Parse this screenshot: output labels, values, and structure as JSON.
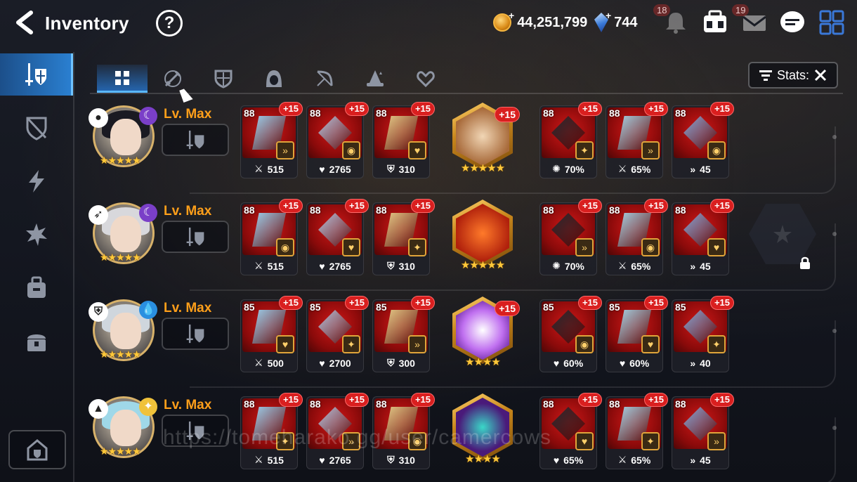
{
  "header": {
    "title": "Inventory",
    "help": "?",
    "gold": "44,251,799",
    "crystals": "744",
    "notifications": "18",
    "mail": "19"
  },
  "tabs": [
    "all",
    "weapon",
    "armor",
    "helmet",
    "bow",
    "mage",
    "extra"
  ],
  "stats_button": {
    "label": "Stats:"
  },
  "heroes": [
    {
      "level": "Lv. Max",
      "element": "dark",
      "class": "thief",
      "hero_stars": "★★★★★",
      "slots": [
        {
          "lvl": "88",
          "enh": "+15",
          "stat": "515",
          "stat_icon": "attack"
        },
        {
          "lvl": "88",
          "enh": "+15",
          "stat": "2765",
          "stat_icon": "health"
        },
        {
          "lvl": "88",
          "enh": "+15",
          "stat": "310",
          "stat_icon": "defense"
        }
      ],
      "artifact": {
        "enh": "+15",
        "stars": "★★★★★"
      },
      "slots2": [
        {
          "lvl": "88",
          "enh": "+15",
          "stat": "70%",
          "stat_icon": "crit-damage"
        },
        {
          "lvl": "88",
          "enh": "+15",
          "stat": "65%",
          "stat_icon": "attack"
        },
        {
          "lvl": "88",
          "enh": "+15",
          "stat": "45",
          "stat_icon": "speed"
        }
      ]
    },
    {
      "level": "Lv. Max",
      "element": "dark",
      "class": "ranger",
      "hero_stars": "★★★★★",
      "slots": [
        {
          "lvl": "88",
          "enh": "+15",
          "stat": "515",
          "stat_icon": "attack"
        },
        {
          "lvl": "88",
          "enh": "+15",
          "stat": "2765",
          "stat_icon": "health"
        },
        {
          "lvl": "88",
          "enh": "+15",
          "stat": "310",
          "stat_icon": "defense"
        }
      ],
      "artifact": {
        "enh": "",
        "stars": "★★★★★"
      },
      "slots2": [
        {
          "lvl": "88",
          "enh": "+15",
          "stat": "70%",
          "stat_icon": "crit-damage"
        },
        {
          "lvl": "88",
          "enh": "+15",
          "stat": "65%",
          "stat_icon": "attack"
        },
        {
          "lvl": "88",
          "enh": "+15",
          "stat": "45",
          "stat_icon": "speed"
        }
      ]
    },
    {
      "level": "Lv. Max",
      "element": "ice",
      "class": "knight",
      "hero_stars": "★★★★★",
      "slots": [
        {
          "lvl": "85",
          "enh": "+15",
          "stat": "500",
          "stat_icon": "attack"
        },
        {
          "lvl": "85",
          "enh": "+15",
          "stat": "2700",
          "stat_icon": "health"
        },
        {
          "lvl": "85",
          "enh": "+15",
          "stat": "300",
          "stat_icon": "defense"
        }
      ],
      "artifact": {
        "enh": "+15",
        "stars": "★★★★"
      },
      "slots2": [
        {
          "lvl": "85",
          "enh": "+15",
          "stat": "60%",
          "stat_icon": "health"
        },
        {
          "lvl": "85",
          "enh": "+15",
          "stat": "60%",
          "stat_icon": "health"
        },
        {
          "lvl": "85",
          "enh": "+15",
          "stat": "40",
          "stat_icon": "speed"
        }
      ]
    },
    {
      "level": "Lv. Max",
      "element": "light",
      "class": "mage",
      "hero_stars": "★★★★★",
      "slots": [
        {
          "lvl": "88",
          "enh": "+15",
          "stat": "515",
          "stat_icon": "attack"
        },
        {
          "lvl": "88",
          "enh": "+15",
          "stat": "2765",
          "stat_icon": "health"
        },
        {
          "lvl": "88",
          "enh": "+15",
          "stat": "310",
          "stat_icon": "defense"
        }
      ],
      "artifact": {
        "enh": "",
        "stars": "★★★★"
      },
      "slots2": [
        {
          "lvl": "88",
          "enh": "+15",
          "stat": "65%",
          "stat_icon": "health"
        },
        {
          "lvl": "88",
          "enh": "+15",
          "stat": "65%",
          "stat_icon": "attack"
        },
        {
          "lvl": "88",
          "enh": "+15",
          "stat": "45",
          "stat_icon": "speed"
        }
      ]
    }
  ],
  "watermark": "https://tomeharako.gg/user/camercows"
}
